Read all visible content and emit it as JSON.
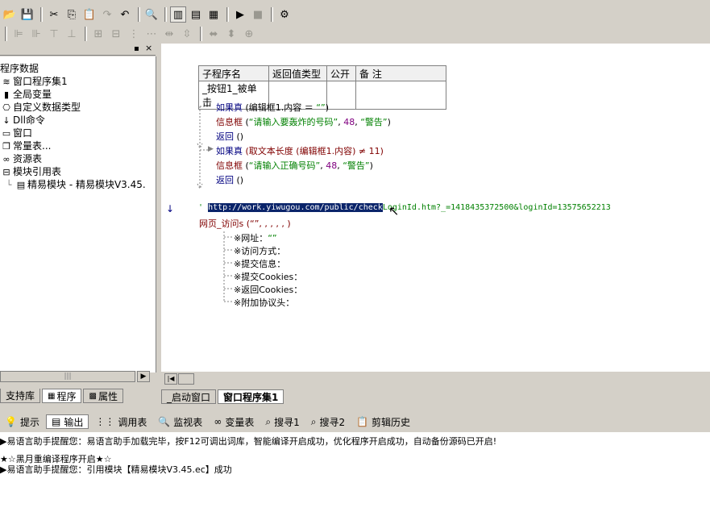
{
  "toolbar1": [
    "open-icon",
    "save-icon",
    "cut-icon",
    "copy-icon",
    "paste-icon",
    "redo-icon",
    "undo-icon",
    "find-icon",
    "layout1-icon",
    "layout2-icon",
    "layout3-icon",
    "run-icon",
    "stop-icon",
    "compile-icon"
  ],
  "left_panel": {
    "root_label": "程序数据",
    "items": [
      {
        "icon": "window-set-icon",
        "label": "窗口程序集1"
      },
      {
        "icon": "global-var-icon",
        "label": "全局变量"
      },
      {
        "icon": "datatype-icon",
        "label": "自定义数据类型"
      },
      {
        "icon": "dll-icon",
        "label": "Dll命令"
      },
      {
        "icon": "window-icon",
        "label": "窗口"
      },
      {
        "icon": "constant-icon",
        "label": "常量表..."
      },
      {
        "icon": "resource-icon",
        "label": "资源表"
      },
      {
        "icon": "module-icon",
        "label": "模块引用表"
      },
      {
        "icon": "module-file-icon",
        "label": "精易模块 - 精易模块V3.45."
      }
    ],
    "tabs": [
      "支持库",
      "程序",
      "属性"
    ]
  },
  "editor": {
    "table_headers": [
      "子程序名",
      "返回值类型",
      "公开",
      "备 注"
    ],
    "sub_name": "_按钮1_被单击",
    "lines": [
      {
        "a": "如果真",
        "b": " (编辑框1.内容 ＝ ",
        "c": "“”",
        "d": ")"
      },
      {
        "a": "信息框",
        "b": " (",
        "c": "“请输入要轰炸的号码”",
        "d": ", ",
        "e": "48",
        "f": ", ",
        "g": "“警告”",
        "h": ")"
      },
      {
        "a": "返回",
        "b": " ()"
      },
      {
        "a": "如果真",
        "b": " (取文本长度 (编辑框1.内容) ≠ 11)"
      },
      {
        "a": "信息框",
        "b": " (",
        "c": "“请输入正确号码”",
        "d": ", ",
        "e": "48",
        "f": ", ",
        "g": "“警告”",
        "h": ")"
      },
      {
        "a": "返回",
        "b": " ()"
      }
    ],
    "url_selected": "http://work.yiwugou.com/public/check",
    "url_rest": "LoginId.htm?_=1418435372500&loginId=13575652213",
    "call_line": "网页_访问s (“”, , , , , )",
    "params": [
      "※网址：",
      "※访问方式：",
      "※提交信息：",
      "※提交Cookies：",
      "※返回Cookies：",
      "※附加协议头："
    ],
    "param_values": [
      "“”",
      "",
      "",
      "",
      "",
      ""
    ],
    "tabs": [
      "_启动窗口",
      "窗口程序集1"
    ]
  },
  "bottom_tabs": [
    {
      "icon": "hint-icon",
      "label": "提示"
    },
    {
      "icon": "output-icon",
      "label": "输出"
    },
    {
      "icon": "calltable-icon",
      "label": "调用表"
    },
    {
      "icon": "monitor-icon",
      "label": "监视表"
    },
    {
      "icon": "vars-icon",
      "label": "变量表"
    },
    {
      "icon": "search1-icon",
      "label": "搜寻1"
    },
    {
      "icon": "search2-icon",
      "label": "搜寻2"
    },
    {
      "icon": "clipboard-icon",
      "label": "剪辑历史"
    }
  ],
  "output_lines": [
    "▶易语言助手提醒您：易语言助手加载完毕，按F12可调出词库，智能编译开启成功，优化程序开启成功，自动备份源码已开启!",
    "",
    "★☆黑月重编译程序开启★☆",
    "▶易语言助手提醒您：引用模块【精易模块V3.45.ec】成功"
  ]
}
